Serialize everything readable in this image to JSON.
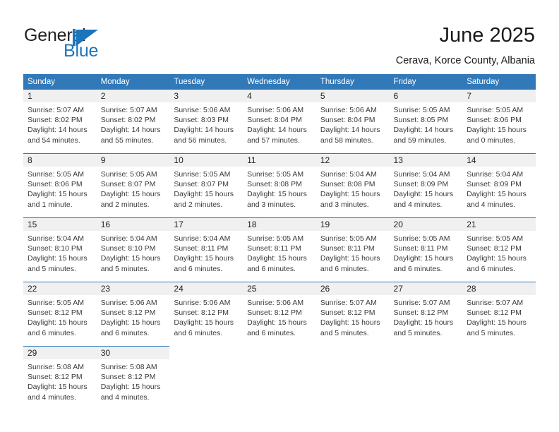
{
  "brand": {
    "word_one": "General",
    "word_two": "Blue",
    "mark": "triangle-logo",
    "color_primary": "#1b75bb",
    "color_text": "#231f20"
  },
  "header": {
    "title": "June 2025",
    "location": "Cerava, Korce County, Albania",
    "header_bg": "#3179b8",
    "daynum_bg": "#f0f0f0"
  },
  "weekday_headers": [
    "Sunday",
    "Monday",
    "Tuesday",
    "Wednesday",
    "Thursday",
    "Friday",
    "Saturday"
  ],
  "weeks": [
    [
      {
        "day": "1",
        "sunrise": "Sunrise: 5:07 AM",
        "sunset": "Sunset: 8:02 PM",
        "daylight_1": "Daylight: 14 hours",
        "daylight_2": "and 54 minutes."
      },
      {
        "day": "2",
        "sunrise": "Sunrise: 5:07 AM",
        "sunset": "Sunset: 8:02 PM",
        "daylight_1": "Daylight: 14 hours",
        "daylight_2": "and 55 minutes."
      },
      {
        "day": "3",
        "sunrise": "Sunrise: 5:06 AM",
        "sunset": "Sunset: 8:03 PM",
        "daylight_1": "Daylight: 14 hours",
        "daylight_2": "and 56 minutes."
      },
      {
        "day": "4",
        "sunrise": "Sunrise: 5:06 AM",
        "sunset": "Sunset: 8:04 PM",
        "daylight_1": "Daylight: 14 hours",
        "daylight_2": "and 57 minutes."
      },
      {
        "day": "5",
        "sunrise": "Sunrise: 5:06 AM",
        "sunset": "Sunset: 8:04 PM",
        "daylight_1": "Daylight: 14 hours",
        "daylight_2": "and 58 minutes."
      },
      {
        "day": "6",
        "sunrise": "Sunrise: 5:05 AM",
        "sunset": "Sunset: 8:05 PM",
        "daylight_1": "Daylight: 14 hours",
        "daylight_2": "and 59 minutes."
      },
      {
        "day": "7",
        "sunrise": "Sunrise: 5:05 AM",
        "sunset": "Sunset: 8:06 PM",
        "daylight_1": "Daylight: 15 hours",
        "daylight_2": "and 0 minutes."
      }
    ],
    [
      {
        "day": "8",
        "sunrise": "Sunrise: 5:05 AM",
        "sunset": "Sunset: 8:06 PM",
        "daylight_1": "Daylight: 15 hours",
        "daylight_2": "and 1 minute."
      },
      {
        "day": "9",
        "sunrise": "Sunrise: 5:05 AM",
        "sunset": "Sunset: 8:07 PM",
        "daylight_1": "Daylight: 15 hours",
        "daylight_2": "and 2 minutes."
      },
      {
        "day": "10",
        "sunrise": "Sunrise: 5:05 AM",
        "sunset": "Sunset: 8:07 PM",
        "daylight_1": "Daylight: 15 hours",
        "daylight_2": "and 2 minutes."
      },
      {
        "day": "11",
        "sunrise": "Sunrise: 5:05 AM",
        "sunset": "Sunset: 8:08 PM",
        "daylight_1": "Daylight: 15 hours",
        "daylight_2": "and 3 minutes."
      },
      {
        "day": "12",
        "sunrise": "Sunrise: 5:04 AM",
        "sunset": "Sunset: 8:08 PM",
        "daylight_1": "Daylight: 15 hours",
        "daylight_2": "and 3 minutes."
      },
      {
        "day": "13",
        "sunrise": "Sunrise: 5:04 AM",
        "sunset": "Sunset: 8:09 PM",
        "daylight_1": "Daylight: 15 hours",
        "daylight_2": "and 4 minutes."
      },
      {
        "day": "14",
        "sunrise": "Sunrise: 5:04 AM",
        "sunset": "Sunset: 8:09 PM",
        "daylight_1": "Daylight: 15 hours",
        "daylight_2": "and 4 minutes."
      }
    ],
    [
      {
        "day": "15",
        "sunrise": "Sunrise: 5:04 AM",
        "sunset": "Sunset: 8:10 PM",
        "daylight_1": "Daylight: 15 hours",
        "daylight_2": "and 5 minutes."
      },
      {
        "day": "16",
        "sunrise": "Sunrise: 5:04 AM",
        "sunset": "Sunset: 8:10 PM",
        "daylight_1": "Daylight: 15 hours",
        "daylight_2": "and 5 minutes."
      },
      {
        "day": "17",
        "sunrise": "Sunrise: 5:04 AM",
        "sunset": "Sunset: 8:11 PM",
        "daylight_1": "Daylight: 15 hours",
        "daylight_2": "and 6 minutes."
      },
      {
        "day": "18",
        "sunrise": "Sunrise: 5:05 AM",
        "sunset": "Sunset: 8:11 PM",
        "daylight_1": "Daylight: 15 hours",
        "daylight_2": "and 6 minutes."
      },
      {
        "day": "19",
        "sunrise": "Sunrise: 5:05 AM",
        "sunset": "Sunset: 8:11 PM",
        "daylight_1": "Daylight: 15 hours",
        "daylight_2": "and 6 minutes."
      },
      {
        "day": "20",
        "sunrise": "Sunrise: 5:05 AM",
        "sunset": "Sunset: 8:11 PM",
        "daylight_1": "Daylight: 15 hours",
        "daylight_2": "and 6 minutes."
      },
      {
        "day": "21",
        "sunrise": "Sunrise: 5:05 AM",
        "sunset": "Sunset: 8:12 PM",
        "daylight_1": "Daylight: 15 hours",
        "daylight_2": "and 6 minutes."
      }
    ],
    [
      {
        "day": "22",
        "sunrise": "Sunrise: 5:05 AM",
        "sunset": "Sunset: 8:12 PM",
        "daylight_1": "Daylight: 15 hours",
        "daylight_2": "and 6 minutes."
      },
      {
        "day": "23",
        "sunrise": "Sunrise: 5:06 AM",
        "sunset": "Sunset: 8:12 PM",
        "daylight_1": "Daylight: 15 hours",
        "daylight_2": "and 6 minutes."
      },
      {
        "day": "24",
        "sunrise": "Sunrise: 5:06 AM",
        "sunset": "Sunset: 8:12 PM",
        "daylight_1": "Daylight: 15 hours",
        "daylight_2": "and 6 minutes."
      },
      {
        "day": "25",
        "sunrise": "Sunrise: 5:06 AM",
        "sunset": "Sunset: 8:12 PM",
        "daylight_1": "Daylight: 15 hours",
        "daylight_2": "and 6 minutes."
      },
      {
        "day": "26",
        "sunrise": "Sunrise: 5:07 AM",
        "sunset": "Sunset: 8:12 PM",
        "daylight_1": "Daylight: 15 hours",
        "daylight_2": "and 5 minutes."
      },
      {
        "day": "27",
        "sunrise": "Sunrise: 5:07 AM",
        "sunset": "Sunset: 8:12 PM",
        "daylight_1": "Daylight: 15 hours",
        "daylight_2": "and 5 minutes."
      },
      {
        "day": "28",
        "sunrise": "Sunrise: 5:07 AM",
        "sunset": "Sunset: 8:12 PM",
        "daylight_1": "Daylight: 15 hours",
        "daylight_2": "and 5 minutes."
      }
    ],
    [
      {
        "day": "29",
        "sunrise": "Sunrise: 5:08 AM",
        "sunset": "Sunset: 8:12 PM",
        "daylight_1": "Daylight: 15 hours",
        "daylight_2": "and 4 minutes."
      },
      {
        "day": "30",
        "sunrise": "Sunrise: 5:08 AM",
        "sunset": "Sunset: 8:12 PM",
        "daylight_1": "Daylight: 15 hours",
        "daylight_2": "and 4 minutes."
      },
      {
        "day": "",
        "sunrise": "",
        "sunset": "",
        "daylight_1": "",
        "daylight_2": ""
      },
      {
        "day": "",
        "sunrise": "",
        "sunset": "",
        "daylight_1": "",
        "daylight_2": ""
      },
      {
        "day": "",
        "sunrise": "",
        "sunset": "",
        "daylight_1": "",
        "daylight_2": ""
      },
      {
        "day": "",
        "sunrise": "",
        "sunset": "",
        "daylight_1": "",
        "daylight_2": ""
      },
      {
        "day": "",
        "sunrise": "",
        "sunset": "",
        "daylight_1": "",
        "daylight_2": ""
      }
    ]
  ]
}
